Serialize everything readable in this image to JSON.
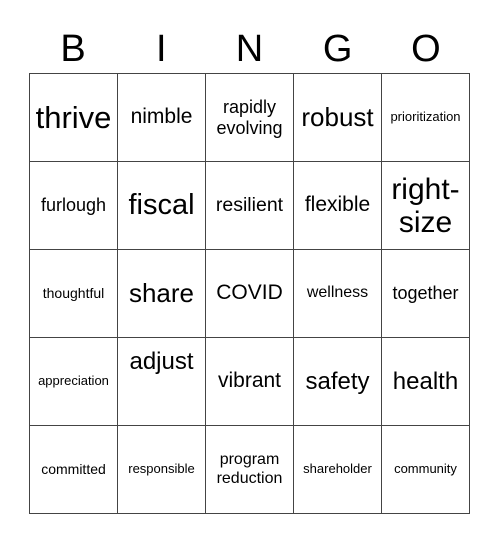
{
  "header": [
    "B",
    "I",
    "N",
    "G",
    "O"
  ],
  "cells": [
    [
      "thrive",
      "nimble",
      "rapidly evolving",
      "robust",
      "prioritization"
    ],
    [
      "furlough",
      "fiscal",
      "resilient",
      "flexible",
      "right-size"
    ],
    [
      "thoughtful",
      "share",
      "COVID",
      "wellness",
      "together"
    ],
    [
      "appreciation",
      "adjust",
      "vibrant",
      "safety",
      "health"
    ],
    [
      "committed",
      "responsible",
      "program reduction",
      "shareholder",
      "community"
    ]
  ]
}
